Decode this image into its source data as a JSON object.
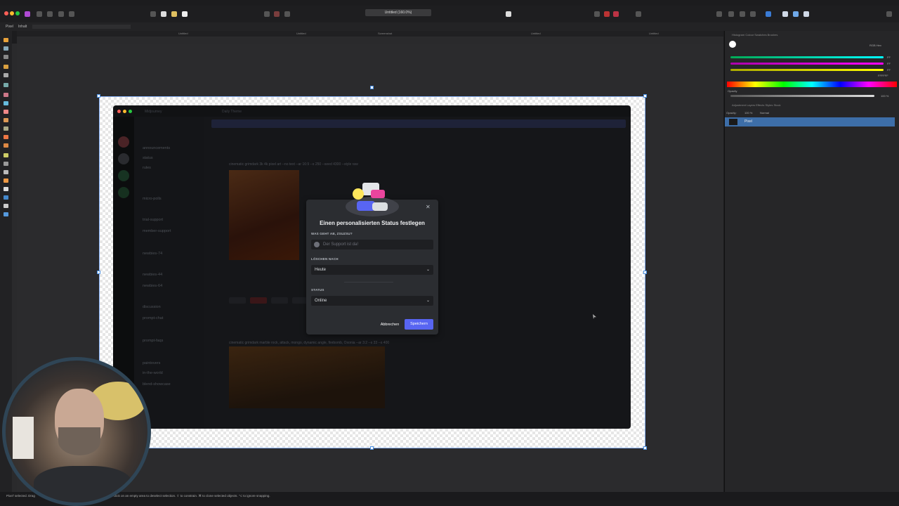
{
  "app": {
    "document_tab": "Untitled (160.0%)",
    "context_left": [
      "Pixel",
      "Inhalt"
    ],
    "canvas_tabs": [
      "Untitled",
      "Untitled",
      "Untitled",
      "Screenshot",
      "Untitled",
      "Untitled"
    ]
  },
  "right_panel": {
    "top_tabs": "Histogram  Colour  Swatches  Brushes",
    "mode": "RGB Hex",
    "channel_values": [
      "FF",
      "FF",
      "FF"
    ],
    "hex_value": "FFFFFF",
    "opacity_label": "Opacity",
    "opacity_value": "100 %",
    "layer_tabs": "Adjustment  Layers  Effects  Styles  Stock",
    "layer_opacity_label": "Opacity:",
    "layer_opacity": "100 %",
    "blend_mode": "Normal",
    "layer_name": "Pixel"
  },
  "discord": {
    "server_name": "Midjourney",
    "channel_title": "Daily Theme",
    "banner": "",
    "channel_groups": [
      "announcements",
      "status",
      "rules",
      "micro-polls",
      "trial-support",
      "member-support",
      "newbies-74",
      "newbies-44",
      "newbies-64",
      "discussion",
      "prompt-chat",
      "prompt-faqs",
      "paintovers",
      "in-the-world",
      "blend-showcase"
    ],
    "message_line1": "cinematic grimdark 3k 4k pixel art --no text --ar 16:9 --s 250 --seed 4300 --style raw",
    "message_line2": "cinematic grimdark marble rock, attack, mongo, dynamic angle, firebomb, Oxonia --ar 3:2 --s 33 --s 400"
  },
  "modal": {
    "title": "Einen personalisierten Status festlegen",
    "status_label": "WAS GEHT AB, ZSUZSU?",
    "status_placeholder": "Der Support ist da!",
    "clear_label": "LÖSCHEN NACH",
    "clear_value": "Heute",
    "state_label": "STATUS",
    "state_value": "Online",
    "cancel": "Abbrechen",
    "save": "Speichern",
    "close_glyph": "✕",
    "chevron_glyph": "⌄"
  },
  "status_bar": {
    "text1": "Pixel' selected. Drag",
    "text2": "click on an empty area to deselect selection. ⇧ to constrain. ⌘ to clone selected objects. ⌥ to ignore snapping."
  },
  "colors": {
    "accent": "#5865f2",
    "layer_selected": "#3d6ea8",
    "artboard_border": "#8ab4f8",
    "webcam_border": "#2f4556"
  }
}
